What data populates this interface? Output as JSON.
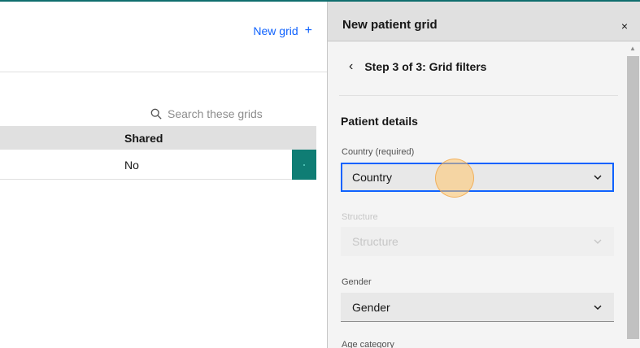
{
  "left": {
    "new_grid_label": "New grid",
    "new_grid_icon": "+",
    "search_placeholder": "Search these grids",
    "table": {
      "columns": [
        "Shared"
      ],
      "rows": [
        {
          "shared": "No"
        }
      ]
    }
  },
  "panel": {
    "title": "New patient grid",
    "close_icon": "×",
    "back_icon": "‹",
    "step_label": "Step 3 of 3: Grid filters",
    "section_title": "Patient details",
    "fields": [
      {
        "label": "Country (required)",
        "value": "Country",
        "state": "focused"
      },
      {
        "label": "Structure",
        "value": "Structure",
        "state": "disabled"
      },
      {
        "label": "Gender",
        "value": "Gender",
        "state": "normal"
      },
      {
        "label": "Age category",
        "value": "",
        "state": "normal"
      }
    ]
  },
  "colors": {
    "accent_teal": "#0f7d74",
    "focus_blue": "#0f62fe",
    "link_blue": "#0f62fe"
  }
}
